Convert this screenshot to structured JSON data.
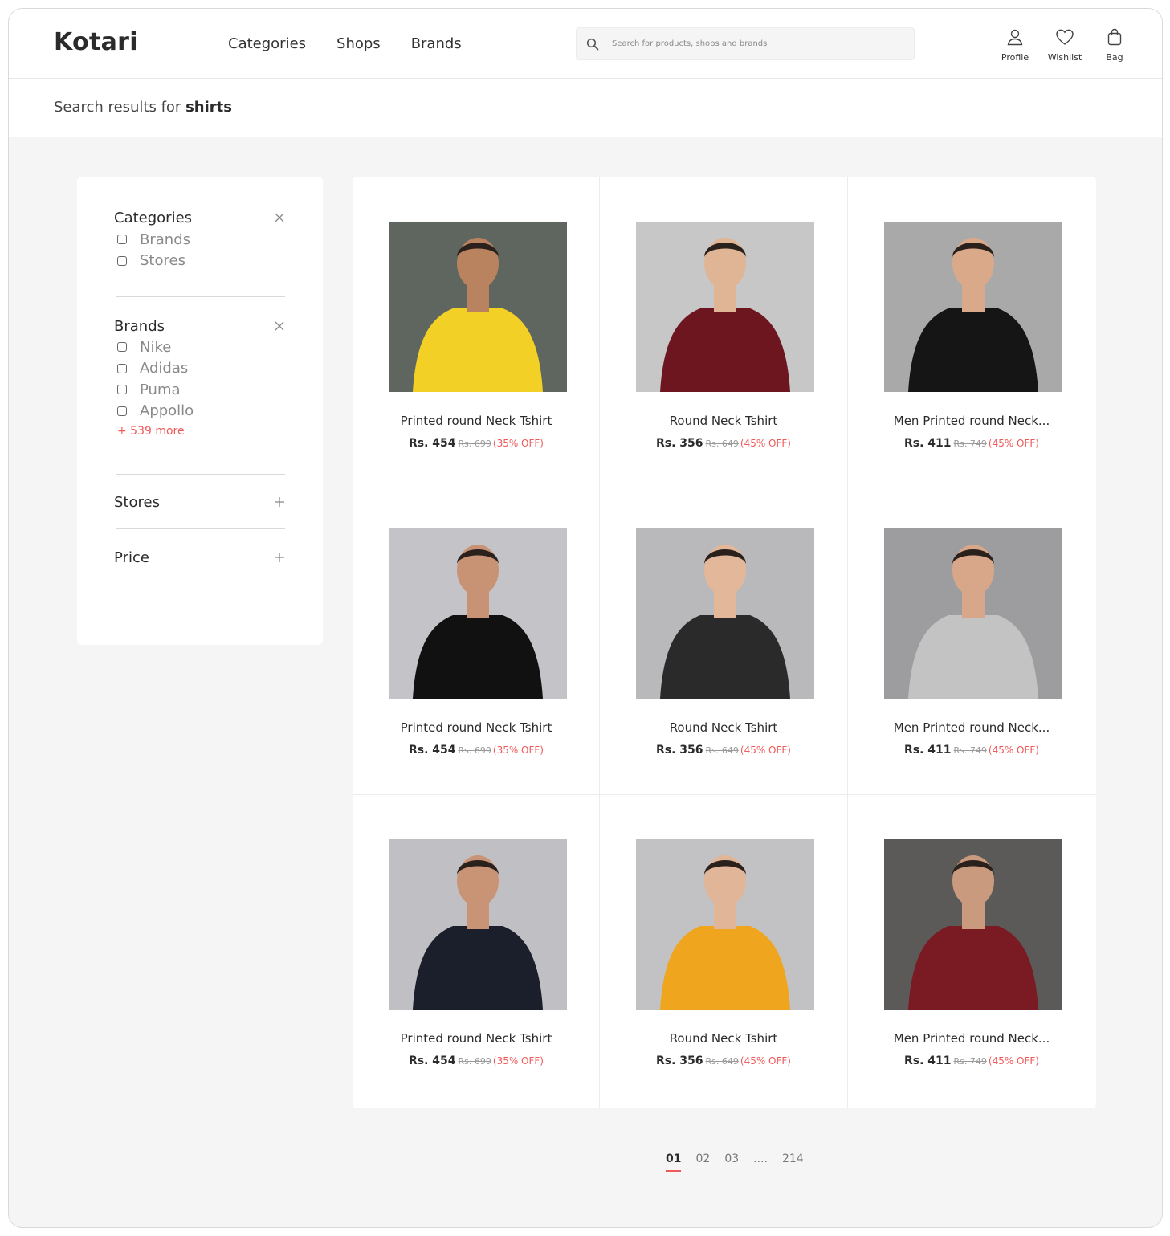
{
  "header": {
    "logo": "Kotari",
    "nav": [
      "Categories",
      "Shops",
      "Brands"
    ],
    "search_placeholder": "Search for products, shops and brands",
    "icons": [
      {
        "label": "Profile",
        "icon": "user-icon"
      },
      {
        "label": "Wishlist",
        "icon": "heart-icon"
      },
      {
        "label": "Bag",
        "icon": "bag-icon"
      }
    ]
  },
  "results": {
    "prefix": "Search results for",
    "query": "shirts"
  },
  "filters": {
    "categories": {
      "title": "Categories",
      "items": [
        "Brands",
        "Stores"
      ]
    },
    "brands": {
      "title": "Brands",
      "items": [
        "Nike",
        "Adidas",
        "Puma",
        "Appollo"
      ],
      "more": "+ 539 more"
    },
    "stores": {
      "title": "Stores"
    },
    "price": {
      "title": "Price"
    }
  },
  "products": [
    {
      "name": "Printed round Neck Tshirt",
      "price": "Rs. 454",
      "mrp": "Rs. 699",
      "off": "(35% OFF)",
      "shirt": "#f2d026",
      "bg": "#5f6660",
      "skin": "#b9835f"
    },
    {
      "name": "Round Neck Tshirt",
      "price": "Rs. 356",
      "mrp": "Rs. 649",
      "off": "(45% OFF)",
      "shirt": "#6e1620",
      "bg": "#c7c7c7",
      "skin": "#e0b595"
    },
    {
      "name": "Men Printed round Neck...",
      "price": "Rs. 411",
      "mrp": "Rs. 749",
      "off": "(45% OFF)",
      "shirt": "#151515",
      "bg": "#a9a9a9",
      "skin": "#d9a98a"
    },
    {
      "name": "Printed round Neck Tshirt",
      "price": "Rs. 454",
      "mrp": "Rs. 699",
      "off": "(35% OFF)",
      "shirt": "#111111",
      "bg": "#c4c3c8",
      "skin": "#c79374"
    },
    {
      "name": "Round Neck Tshirt",
      "price": "Rs. 356",
      "mrp": "Rs. 649",
      "off": "(45% OFF)",
      "shirt": "#2a2a2a",
      "bg": "#b9b9bb",
      "skin": "#e2b79a"
    },
    {
      "name": "Men Printed round Neck...",
      "price": "Rs. 411",
      "mrp": "Rs. 749",
      "off": "(45% OFF)",
      "shirt": "#c3c3c3",
      "bg": "#9d9d9f",
      "skin": "#d8a789"
    },
    {
      "name": "Printed round Neck Tshirt",
      "price": "Rs. 454",
      "mrp": "Rs. 699",
      "off": "(35% OFF)",
      "shirt": "#1b1f2b",
      "bg": "#c0bfc3",
      "skin": "#c99476"
    },
    {
      "name": "Round Neck Tshirt",
      "price": "Rs. 356",
      "mrp": "Rs. 649",
      "off": "(45% OFF)",
      "shirt": "#f0a51e",
      "bg": "#c2c2c4",
      "skin": "#e1b597"
    },
    {
      "name": "Men Printed round Neck...",
      "price": "Rs. 411",
      "mrp": "Rs. 749",
      "off": "(45% OFF)",
      "shirt": "#7a1b24",
      "bg": "#5b5a58",
      "skin": "#c99a7d"
    }
  ],
  "pagination": {
    "pages": [
      "01",
      "02",
      "03"
    ],
    "dots": "....",
    "last": "214",
    "active": "01"
  },
  "colors": {
    "accent": "#ef5a5a",
    "background": "#f5f5f5"
  }
}
